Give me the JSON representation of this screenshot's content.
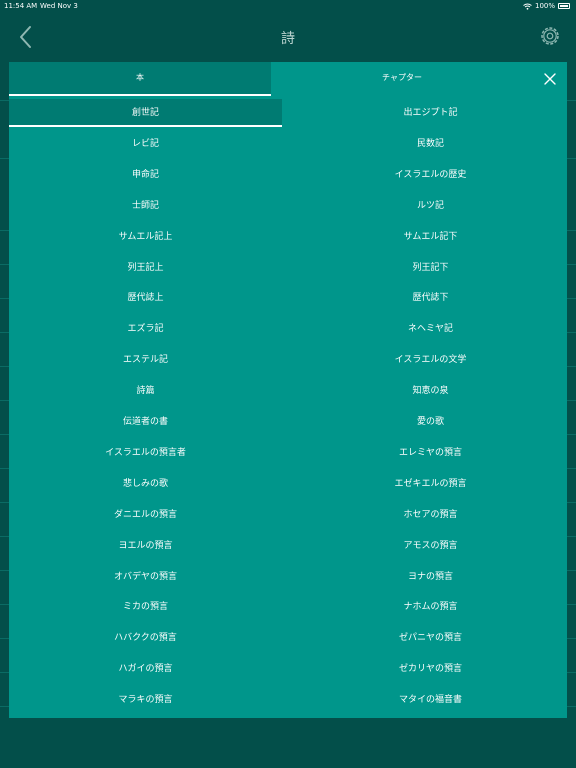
{
  "status": {
    "time": "11:54 AM",
    "date": "Wed Nov 3",
    "battery": "100%"
  },
  "nav": {
    "title": "詩"
  },
  "tabs": {
    "books": "本",
    "chapters": "チャプター"
  },
  "books": [
    {
      "left": "創世記",
      "right": "出エジプト記"
    },
    {
      "left": "レビ記",
      "right": "民数記"
    },
    {
      "left": "申命記",
      "right": "イスラエルの歴史"
    },
    {
      "left": "士師記",
      "right": "ルツ記"
    },
    {
      "left": "サムエル記上",
      "right": "サムエル記下"
    },
    {
      "left": "列王記上",
      "right": "列王記下"
    },
    {
      "left": "歴代誌上",
      "right": "歴代誌下"
    },
    {
      "left": "エズラ記",
      "right": "ネヘミヤ記"
    },
    {
      "left": "エステル記",
      "right": "イスラエルの文学"
    },
    {
      "left": "詩篇",
      "right": "知恵の泉"
    },
    {
      "left": "伝道者の書",
      "right": "愛の歌"
    },
    {
      "left": "イスラエルの預言者",
      "right": "エレミヤの預言"
    },
    {
      "left": "悲しみの歌",
      "right": "エゼキエルの預言"
    },
    {
      "left": "ダニエルの預言",
      "right": "ホセアの預言"
    },
    {
      "left": "ヨエルの預言",
      "right": "アモスの預言"
    },
    {
      "left": "オバデヤの預言",
      "right": "ヨナの預言"
    },
    {
      "left": "ミカの預言",
      "right": "ナホムの預言"
    },
    {
      "left": "ハバククの預言",
      "right": "ゼパニヤの預言"
    },
    {
      "left": "ハガイの預言",
      "right": "ゼカリヤの預言"
    },
    {
      "left": "マラキの預言",
      "right": "マタイの福音書"
    }
  ],
  "selected_book": "創世記",
  "colors": {
    "background": "#034f4a",
    "modal": "#00968b",
    "selected": "#007b72"
  }
}
